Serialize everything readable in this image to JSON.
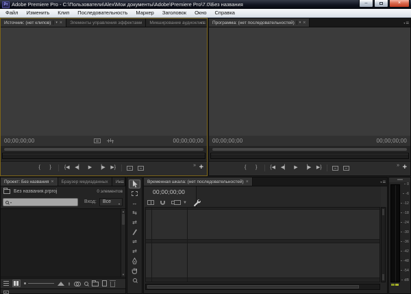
{
  "window": {
    "title": "Adobe Premiere Pro - C:\\Пользователи\\Alex\\Мои документы\\Adobe\\Premiere Pro\\7.0\\Без названия",
    "min": "–",
    "close_glyph": "×"
  },
  "menu": {
    "items": [
      "Файл",
      "Изменить",
      "Клип",
      "Последовательность",
      "Маркер",
      "Заголовок",
      "Окно",
      "Справка"
    ]
  },
  "glyphs": {
    "tab_dropdown": "▾",
    "tab_close": "×",
    "panel_menu": "≡",
    "more": "»",
    "add": "+",
    "scroll_up": "▲",
    "scroll_down": "▼",
    "sort_up": "▲",
    "sort_down": "▼",
    "ripple": "↔",
    "rolling": "⇆",
    "rate_stretch": "⇄",
    "razor": "✂",
    "slip": "⇌",
    "slide": "⇄",
    "marker": "▼"
  },
  "transport": {
    "buttons": [
      "{",
      "}",
      "{◀",
      "◀▏",
      "▶",
      "▕▶",
      "▶}"
    ]
  },
  "source": {
    "tabs": [
      "Источник: (нет клипов)",
      "Элементы управления эффектами",
      "Микширование аудиоклип"
    ],
    "tc_left": "00;00;00;00",
    "tc_right": "00;00;00;00"
  },
  "program": {
    "tab": "Программа: (нет последовательностей)",
    "tc_left": "00;00;00;00",
    "tc_right": "00;00;00;00"
  },
  "project": {
    "tabs": [
      "Проект: Без названия",
      "Браузер медиаданных",
      "Ин"
    ],
    "file": "Без названия.prproj",
    "count": "0 элементов",
    "filter_label": "Вход:",
    "filter_value": "Все"
  },
  "timeline": {
    "tab": "Временная шкала: (нет последовательностей)",
    "timecode": "00;00;00;00"
  },
  "meter": {
    "scale": [
      "0",
      "-6",
      "-12",
      "-18",
      "-24",
      "-30",
      "-36",
      "-42",
      "-48",
      "-54"
    ],
    "unit": "dB"
  }
}
